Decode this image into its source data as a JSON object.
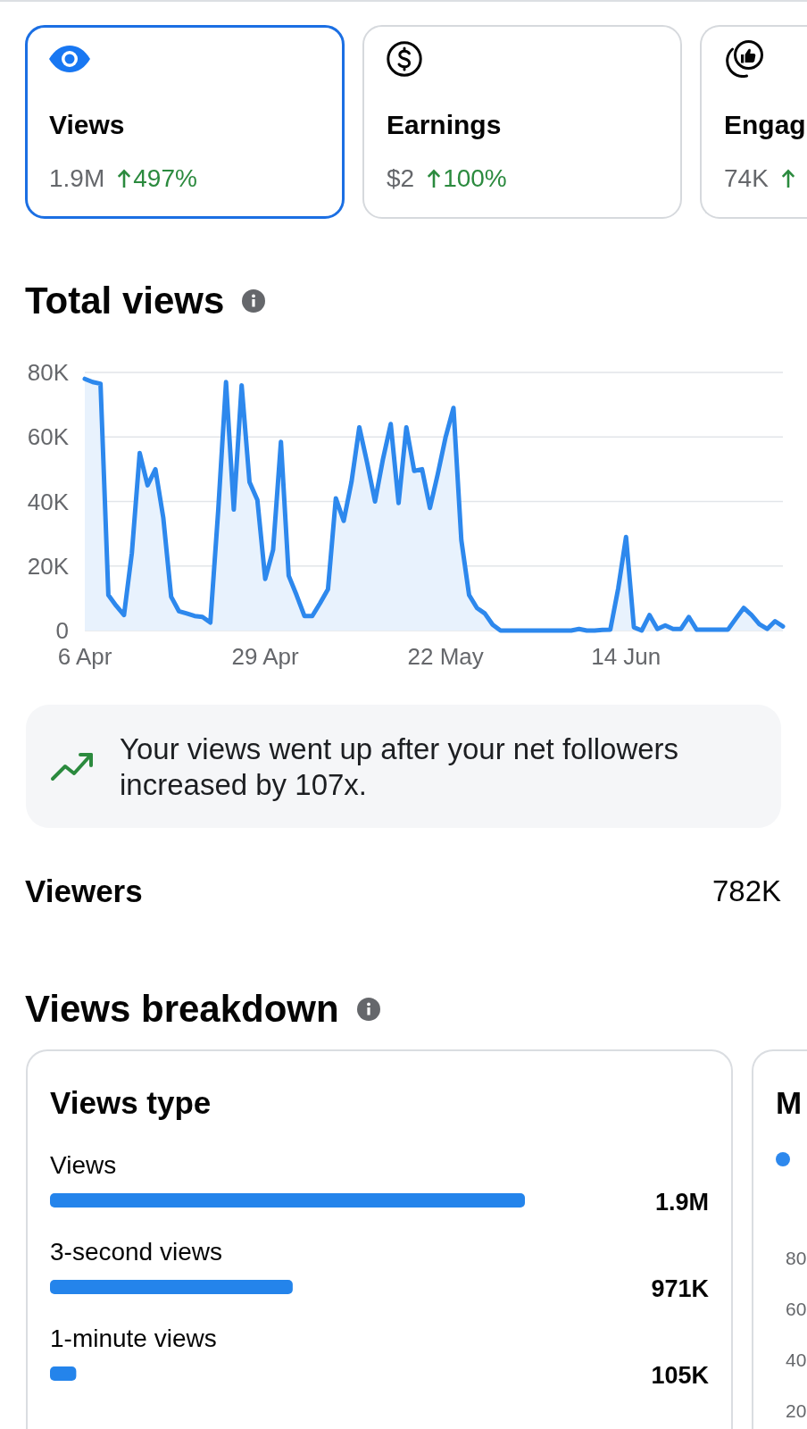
{
  "metric_cards": [
    {
      "kind": "views",
      "title": "Views",
      "value": "1.9M",
      "increase": true,
      "change": "497%",
      "selected": true
    },
    {
      "kind": "earnings",
      "title": "Earnings",
      "value": "$2",
      "increase": true,
      "change": "100%",
      "selected": false
    },
    {
      "kind": "engagement",
      "title": "Engag",
      "value": "74K",
      "increase": true,
      "selected": false
    }
  ],
  "total_views": {
    "chart_data": {
      "type": "area",
      "title": "Total views",
      "grid": true,
      "categories": [
        "6 Apr",
        null,
        null,
        null,
        null,
        null,
        null,
        null,
        null,
        null,
        null,
        null,
        null,
        null,
        null,
        null,
        null,
        null,
        null,
        null,
        null,
        null,
        null,
        "29 Apr",
        null,
        null,
        null,
        null,
        null,
        null,
        null,
        null,
        null,
        null,
        null,
        null,
        null,
        null,
        null,
        null,
        null,
        null,
        null,
        null,
        null,
        null,
        "22 May",
        null,
        null,
        null,
        null,
        null,
        null,
        null,
        null,
        null,
        null,
        null,
        null,
        null,
        null,
        null,
        null,
        null,
        null,
        null,
        null,
        null,
        null,
        "14 Jun",
        null,
        null,
        null,
        null,
        null,
        null,
        null,
        null,
        null,
        null,
        null,
        null,
        null,
        null,
        null,
        null,
        null,
        null,
        null,
        null
      ],
      "values": [
        78000,
        77000,
        76500,
        11000,
        7700,
        4800,
        24000,
        55000,
        45000,
        50000,
        35000,
        10500,
        6000,
        5300,
        4500,
        4200,
        2500,
        37000,
        77000,
        37500,
        76000,
        46000,
        40500,
        16000,
        25000,
        58500,
        17000,
        11000,
        4500,
        4500,
        8500,
        12800,
        41000,
        34000,
        46000,
        63000,
        52000,
        40000,
        53000,
        64000,
        39500,
        63000,
        49500,
        50000,
        38000,
        48500,
        60000,
        69000,
        28000,
        11000,
        7000,
        5300,
        1800,
        0,
        0,
        0,
        0,
        0,
        0,
        0,
        0,
        0,
        0,
        500,
        0,
        0,
        200,
        300,
        13000,
        29000,
        1000,
        0,
        4800,
        500,
        1600,
        500,
        500,
        4200,
        300,
        300,
        300,
        300,
        300,
        3700,
        7000,
        4800,
        2000,
        500,
        2900,
        1300
      ],
      "ylim": [
        0,
        80000
      ],
      "yticks": [
        {
          "value": 0,
          "label": "0"
        },
        {
          "value": 20000,
          "label": "20K"
        },
        {
          "value": 40000,
          "label": "40K"
        },
        {
          "value": 60000,
          "label": "60K"
        },
        {
          "value": 80000,
          "label": "80K"
        }
      ]
    }
  },
  "insight": {
    "increase": true,
    "text": "Your views went up after your net followers increased by 107x."
  },
  "viewers": {
    "label": "Viewers",
    "value": "782K"
  },
  "views_breakdown": {
    "title": "Views breakdown",
    "cards": [
      {
        "kind": "bars",
        "chart_data": {
          "type": "bar",
          "orientation": "horizontal",
          "title": "Views type",
          "categories": [
            "Views",
            "3-second views",
            "1-minute views"
          ],
          "values": [
            1900000,
            971000,
            105000
          ],
          "value_labels": [
            "1.9M",
            "971K",
            "105K"
          ]
        }
      },
      {
        "kind": "chart",
        "title": "M",
        "legend": [
          {
            "color": "#2d88ed"
          }
        ],
        "axis_labels": [
          "80",
          "60",
          "40",
          "20"
        ]
      }
    ]
  }
}
